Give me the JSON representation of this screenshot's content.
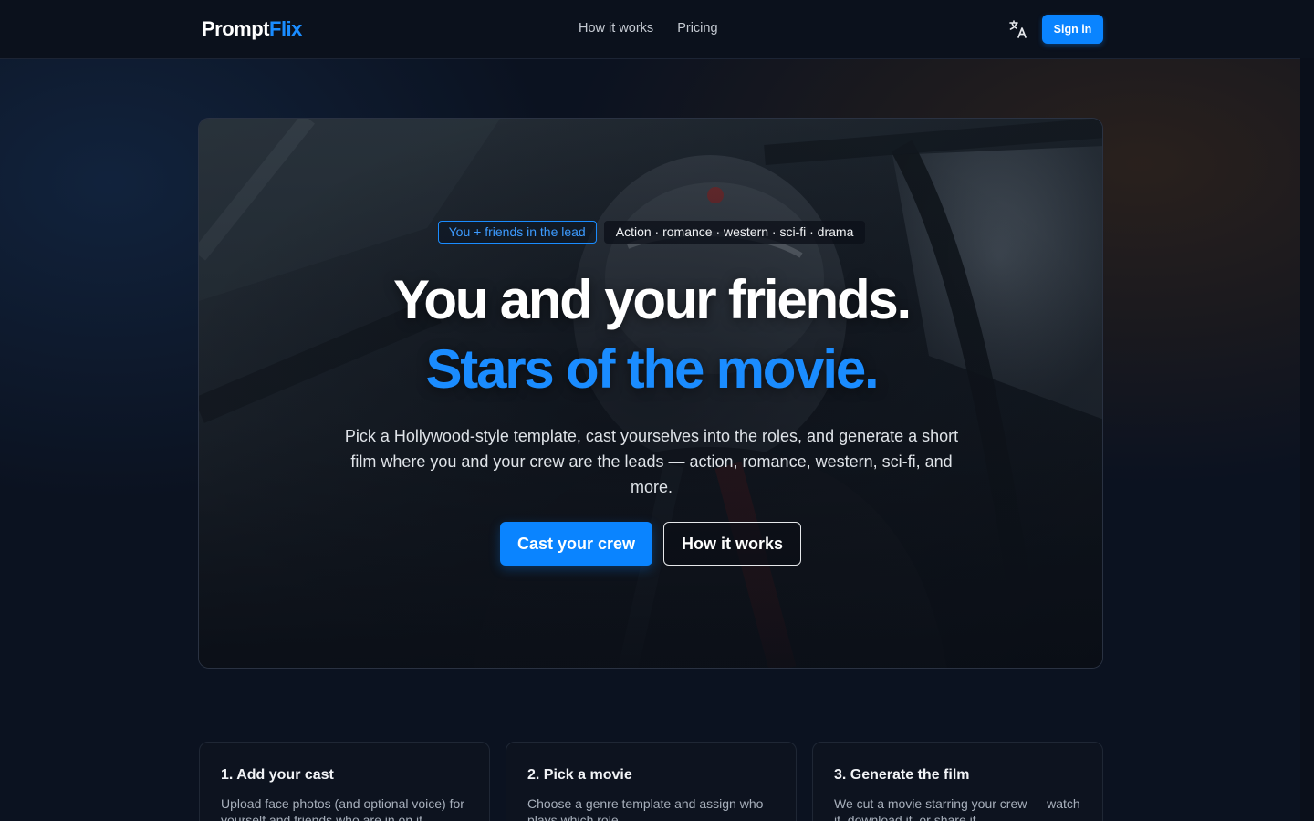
{
  "brand": {
    "name_part1": "Prompt",
    "name_part2": "Flix"
  },
  "nav": {
    "how_it_works": "How it works",
    "pricing": "Pricing"
  },
  "header": {
    "translate_icon": "translate-icon",
    "sign_in": "Sign in"
  },
  "hero": {
    "pill_primary": "You + friends in the lead",
    "pill_genres": "Action · romance · western · sci-fi · drama",
    "headline_line1": "You and your friends.",
    "headline_line2": "Stars of the movie.",
    "subtext": "Pick a Hollywood-style template, cast yourselves into the roles, and generate a short film where you and your crew are the leads — action, romance, western, sci-fi, and more.",
    "cta_primary": "Cast your crew",
    "cta_secondary": "How it works"
  },
  "steps": [
    {
      "title": "1. Add your cast",
      "description": "Upload face photos (and optional voice) for yourself and friends who are in on it."
    },
    {
      "title": "2. Pick a movie",
      "description": "Choose a genre template and assign who plays which role."
    },
    {
      "title": "3. Generate the film",
      "description": "We cut a movie starring your crew — watch it, download it, or share it."
    }
  ],
  "colors": {
    "accent": "#0a84ff",
    "accent_text": "#1a8cff",
    "background": "#0b1220"
  }
}
